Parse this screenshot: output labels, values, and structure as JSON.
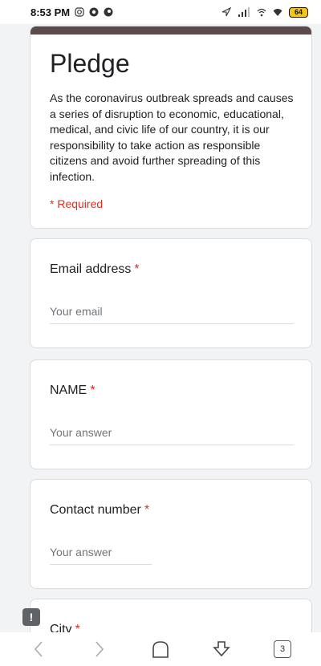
{
  "status_bar": {
    "time": "8:53 PM",
    "battery_level": "64"
  },
  "form": {
    "title": "Pledge",
    "description": "As the coronavirus outbreak spreads and causes a series of disruption to economic, educational, medical, and civic life of our country, it is our responsibility to take action as responsible citizens and avoid further spreading of this infection.",
    "required_note": "* Required",
    "questions": [
      {
        "label": "Email address",
        "required_mark": "*",
        "placeholder": "Your email"
      },
      {
        "label": "NAME",
        "required_mark": "*",
        "placeholder": "Your answer"
      },
      {
        "label": "Contact number",
        "required_mark": "*",
        "placeholder": "Your answer"
      },
      {
        "label": "City",
        "required_mark": "*"
      }
    ]
  },
  "browser_nav": {
    "tab_count": "3"
  },
  "colors": {
    "header_band": "#5d4a4a",
    "required_red": "#d93025",
    "page_bg": "#f1f3f4",
    "battery": "#f5c518"
  },
  "icons": {
    "status_left": [
      "instagram-icon",
      "chrome-icon",
      "browser-icon"
    ],
    "status_right": [
      "navigation-icon",
      "signal-icon",
      "hotspot-icon",
      "wifi-icon",
      "battery-icon"
    ],
    "nav": [
      "back-icon",
      "forward-icon",
      "home-icon",
      "download-icon",
      "tabs-icon"
    ],
    "floating": "feedback-icon"
  }
}
